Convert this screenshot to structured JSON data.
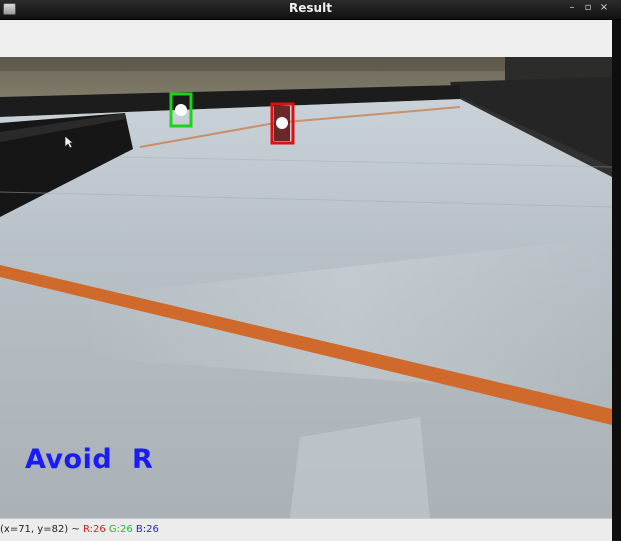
{
  "window": {
    "title": "Result",
    "controls": {
      "minimize": "–",
      "maximize": "▫",
      "close": "×"
    }
  },
  "overlay": {
    "text": "Avoid  R",
    "color": "#1a1aff"
  },
  "detections": {
    "green_box_color": "#1ad41a",
    "red_box_color": "#e01010"
  },
  "status": {
    "coords": "(x=71, y=82) ~",
    "r": "R:26",
    "g": "G:26",
    "b": "B:26"
  }
}
